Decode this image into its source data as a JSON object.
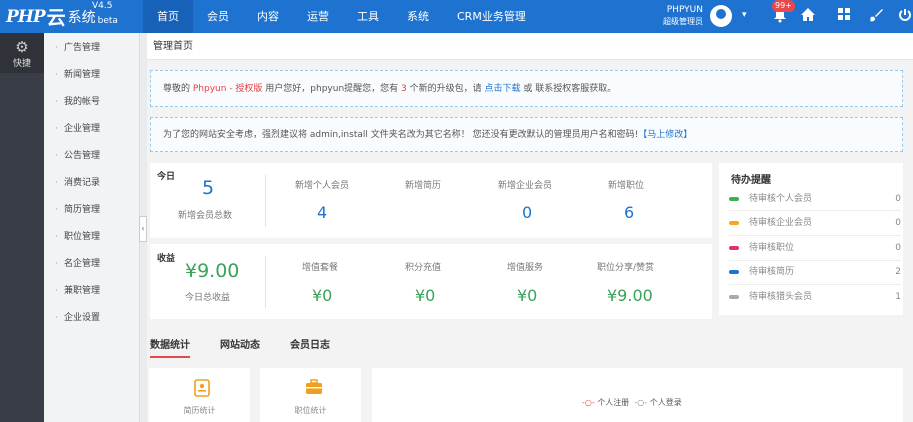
{
  "topbar": {
    "logo_php": "PHP",
    "logo_yun": "云",
    "logo_sys": "系统",
    "logo_beta": "beta",
    "version": "V4.5",
    "nav": [
      "首页",
      "会员",
      "内容",
      "运营",
      "工具",
      "系统",
      "CRM业务管理"
    ],
    "user_name": "PHPYUN",
    "user_role": "超级管理员",
    "notification_count": "99+",
    "icons": [
      "avatar-icon",
      "caret-down-icon",
      "bell-icon",
      "home-icon",
      "grid-icon",
      "brush-icon",
      "power-icon"
    ]
  },
  "leftbar": {
    "item_label": "快捷",
    "icon": "gear-icon"
  },
  "subnav": [
    "广告管理",
    "新闻管理",
    "我的帐号",
    "企业管理",
    "公告管理",
    "消费记录",
    "简历管理",
    "职位管理",
    "名企管理",
    "兼职管理",
    "企业设置"
  ],
  "breadcrumb": "管理首页",
  "notice1": {
    "pre": "尊敬的 ",
    "brand": "Phpyun - 授权版",
    "mid": " 用户您好，phpyun提醒您，您有 ",
    "count": "3",
    "mid2": " 个新的升级包，请 ",
    "link": "点击下载",
    "post": " 或 联系授权客服获取。"
  },
  "notice2": {
    "text": "为了您的网站安全考虑，强烈建议将 admin,install 文件夹名改为其它名称！ 您还没有更改默认的管理员用户名和密码!",
    "link": "【马上修改】"
  },
  "today": {
    "label": "今日",
    "total": "5",
    "total_label": "新增会员总数",
    "stats": [
      {
        "label": "新增个人会员",
        "value": "4"
      },
      {
        "label": "新增简历",
        "value": ""
      },
      {
        "label": "新增企业会员",
        "value": "0"
      },
      {
        "label": "新增职位",
        "value": "6"
      }
    ]
  },
  "income": {
    "label": "收益",
    "total": "¥9.00",
    "total_label": "今日总收益",
    "stats": [
      {
        "label": "增值套餐",
        "value": "¥0"
      },
      {
        "label": "积分充值",
        "value": "¥0"
      },
      {
        "label": "增值服务",
        "value": "¥0"
      },
      {
        "label": "职位分享/赞赏",
        "value": "¥9.00"
      }
    ]
  },
  "todo": {
    "title": "待办提醒",
    "items": [
      {
        "label": "待审核个人会员",
        "count": "0",
        "color": "#3cb34a"
      },
      {
        "label": "待审核企业会员",
        "count": "0",
        "color": "#f5a623"
      },
      {
        "label": "待审核职位",
        "count": "0",
        "color": "#e0316b"
      },
      {
        "label": "待审核简历",
        "count": "2",
        "color": "#1e73d0"
      },
      {
        "label": "待审核猎头会员",
        "count": "1",
        "color": "#aaaaaa"
      }
    ]
  },
  "tabs": [
    "数据统计",
    "网站动态",
    "会员日志"
  ],
  "quick": [
    {
      "label": "简历统计",
      "icon": "resume-icon"
    },
    {
      "label": "职位统计",
      "icon": "briefcase-icon"
    }
  ],
  "chart_legend": [
    {
      "label": "个人注册",
      "color": "#e24a4a"
    },
    {
      "label": "个人登录",
      "color": "#888888"
    }
  ]
}
